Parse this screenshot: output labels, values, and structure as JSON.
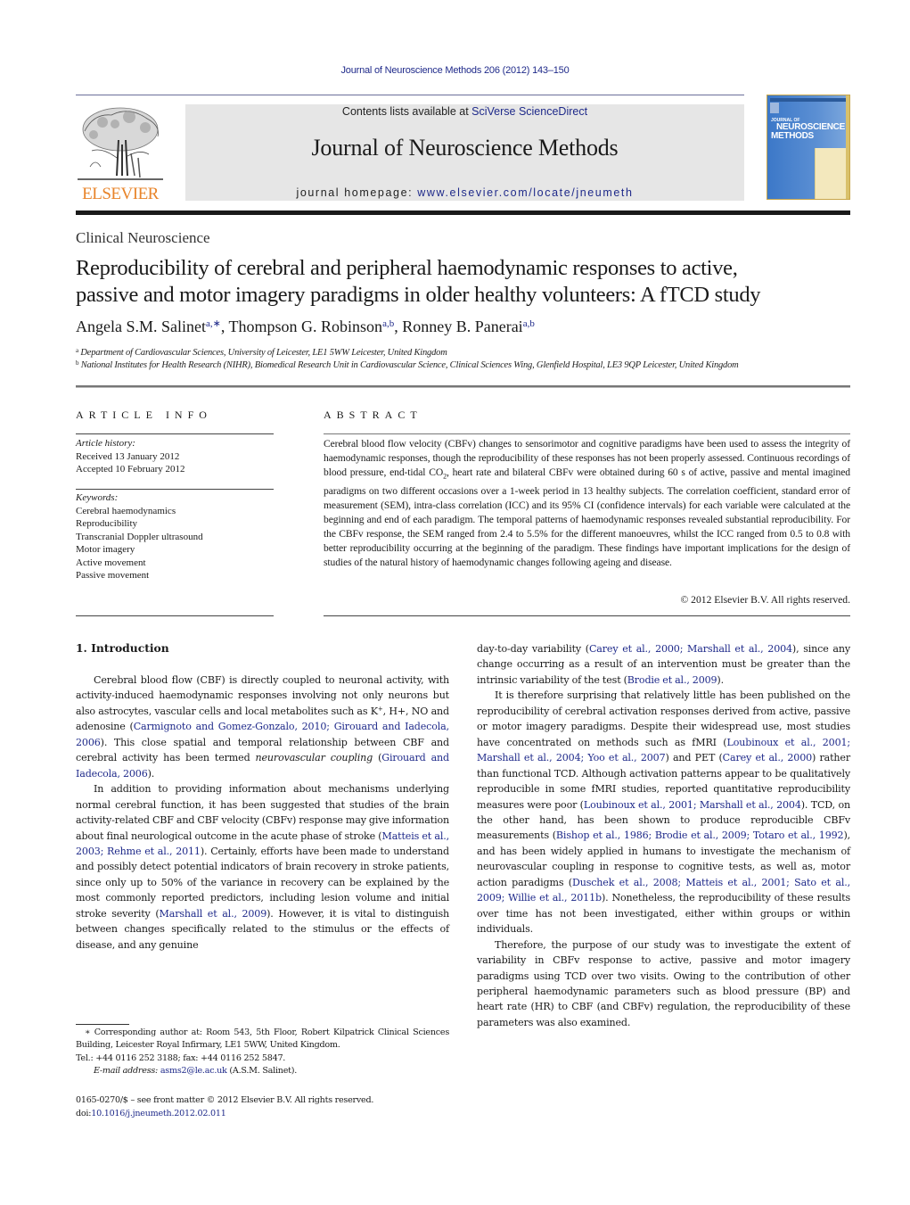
{
  "running_header": "Journal of Neuroscience Methods 206 (2012) 143–150",
  "masthead": {
    "publisher_logo_text": "ELSEVIER",
    "contents_prefix": "Contents lists available at ",
    "contents_link": "SciVerse ScienceDirect",
    "journal_name": "Journal of Neuroscience Methods",
    "homepage_prefix": "journal homepage: ",
    "homepage_link": "www.elsevier.com/locate/jneumeth",
    "cover": {
      "line1": "JOURNAL OF",
      "line2": "NEUROSCIENCE",
      "line3": "METHODS"
    }
  },
  "colors": {
    "link": "#1f2a8a",
    "elsevier_orange": "#e8842a",
    "masthead_gray": "#e6e6e6",
    "cover_blue": "#3c78c8"
  },
  "article": {
    "section": "Clinical Neuroscience",
    "title_line1": "Reproducibility of cerebral and peripheral haemodynamic responses to active,",
    "title_line2": "passive and motor imagery paradigms in older healthy volunteers: A fTCD study",
    "authors": [
      {
        "name": "Angela S.M. Salinet",
        "affil": "a,∗",
        "sep": ", "
      },
      {
        "name": "Thompson G. Robinson",
        "affil": "a,b",
        "sep": ", "
      },
      {
        "name": "Ronney B. Panerai",
        "affil": "a,b",
        "sep": ""
      }
    ],
    "affiliations": [
      {
        "mark": "a",
        "text": "Department of Cardiovascular Sciences, University of Leicester, LE1 5WW Leicester, United Kingdom"
      },
      {
        "mark": "b",
        "text": "National Institutes for Health Research (NIHR), Biomedical Research Unit in Cardiovascular Science, Clinical Sciences Wing, Glenfield Hospital, LE3 9QP Leicester, United Kingdom"
      }
    ]
  },
  "article_info": {
    "heading": "ARTICLE INFO",
    "history_label": "Article history:",
    "received": "Received 13 January 2012",
    "accepted": "Accepted 10 February 2012",
    "keywords_label": "Keywords:",
    "keywords": [
      "Cerebral haemodynamics",
      "Reproducibility",
      "Transcranial Doppler ultrasound",
      "Motor imagery",
      "Active movement",
      "Passive movement"
    ]
  },
  "abstract": {
    "heading": "ABSTRACT",
    "text_part1": "Cerebral blood flow velocity (CBFv) changes to sensorimotor and cognitive paradigms have been used to assess the integrity of haemodynamic responses, though the reproducibility of these responses has not been properly assessed. Continuous recordings of blood pressure, end-tidal CO",
    "text_sub": "2",
    "text_part2": ", heart rate and bilateral CBFv were obtained during 60 s of active, passive and mental imagined paradigms on two different occasions over a 1-week period in 13 healthy subjects. The correlation coefficient, standard error of measurement (SEM), intra-class correlation (ICC) and its 95% CI (confidence intervals) for each variable were calculated at the beginning and end of each paradigm. The temporal patterns of haemodynamic responses revealed substantial reproducibility. For the CBFv response, the SEM ranged from 2.4 to 5.5% for the different manoeuvres, whilst the ICC ranged from 0.5 to 0.8 with better reproducibility occurring at the beginning of the paradigm. These findings have important implications for the design of studies of the natural history of haemodynamic changes following ageing and disease.",
    "copyright": "© 2012 Elsevier B.V. All rights reserved."
  },
  "introduction": {
    "heading": "1.  Introduction",
    "p1": {
      "t1": "Cerebral blood flow (CBF) is directly coupled to neuronal activity, with activity-induced haemodynamic responses involving not only neurons but also astrocytes, vascular cells and local metabolites such as K",
      "sup": "+",
      "t2": ", H+, NO and adenosine (",
      "c1": "Carmignoto and Gomez-Gonzalo, 2010; Girouard and Iadecola, 2006",
      "t3": "). This close spatial and temporal relationship between CBF and cerebral activity has been termed ",
      "em": "neurovascular coupling",
      "t4": " (",
      "c2": "Girouard and Iadecola, 2006",
      "t5": ")."
    },
    "p2": {
      "t1": "In addition to providing information about mechanisms underlying normal cerebral function, it has been suggested that studies of the brain activity-related CBF and CBF velocity (CBFv) response may give information about final neurological outcome in the acute phase of stroke (",
      "c1": "Matteis et al., 2003; Rehme et al., 2011",
      "t2": "). Certainly, efforts have been made to understand and possibly detect potential indicators of brain recovery in stroke patients, since only up to 50% of the variance in recovery can be explained by the most commonly reported predictors, including lesion volume and initial stroke severity (",
      "c2": "Marshall et al., 2009",
      "t3": "). However, it is vital to distinguish between changes specifically related to the stimulus or the effects of disease, and any genuine day-to-day variability (",
      "c3": "Carey et al., 2000; Marshall et al., 2004",
      "t4": "), since any change occurring as a result of an intervention must be greater than the intrinsic variability of the test (",
      "c4": "Brodie et al., 2009",
      "t5": ")."
    },
    "p2_left": "In addition to providing information about mechanisms underlying normal cerebral function, it has been suggested that studies of the brain activity-related CBF and CBF velocity (CBFv) response may give information about final neurological outcome in the acute phase of stroke (",
    "p2_right_start": "day-to-day variability (",
    "p3": {
      "t1": "It is therefore surprising that relatively little has been published on the reproducibility of cerebral activation responses derived from active, passive or motor imagery paradigms. Despite their widespread use, most studies have concentrated on methods such as fMRI (",
      "c1": "Loubinoux et al., 2001; Marshall et al., 2004; Yoo et al., 2007",
      "t2": ") and PET (",
      "c2": "Carey et al., 2000",
      "t3": ") rather than functional TCD. Although activation patterns appear to be qualitatively reproducible in some fMRI studies, reported quantitative reproducibility measures were poor (",
      "c3": "Loubinoux et al., 2001; Marshall et al., 2004",
      "t4": "). TCD, on the other hand, has been shown to produce reproducible CBFv measurements (",
      "c4": "Bishop et al., 1986; Brodie et al., 2009; Totaro et al., 1992",
      "t5": "), and has been widely applied in humans to investigate the mechanism of neurovascular coupling in response to cognitive tests, as well as, motor action paradigms (",
      "c5": "Duschek et al., 2008; Matteis et al., 2001; Sato et al., 2009; Willie et al., 2011b",
      "t6": "). Nonetheless, the reproducibility of these results over time has not been investigated, either within groups or within individuals."
    },
    "p4": "Therefore, the purpose of our study was to investigate the extent of variability in CBFv response to active, passive and motor imagery paradigms using TCD over two visits. Owing to the contribution of other peripheral haemodynamic parameters such as blood pressure (BP) and heart rate (HR) to CBF (and CBFv) regulation, the reproducibility of these parameters was also examined."
  },
  "footnotes": {
    "corresponding": "∗ Corresponding author at: Room 543, 5th Floor, Robert Kilpatrick Clinical Sciences Building, Leicester Royal Infirmary, LE1 5WW, United Kingdom.",
    "tel": "Tel.: +44 0116 252 3188; fax: +44 0116 252 5847.",
    "email_label": "E-mail address: ",
    "email": "asms2@le.ac.uk",
    "email_suffix": " (A.S.M. Salinet).",
    "issn": "0165-0270/$ – see front matter © 2012 Elsevier B.V. All rights reserved.",
    "doi_label": "doi:",
    "doi": "10.1016/j.jneumeth.2012.02.011"
  }
}
